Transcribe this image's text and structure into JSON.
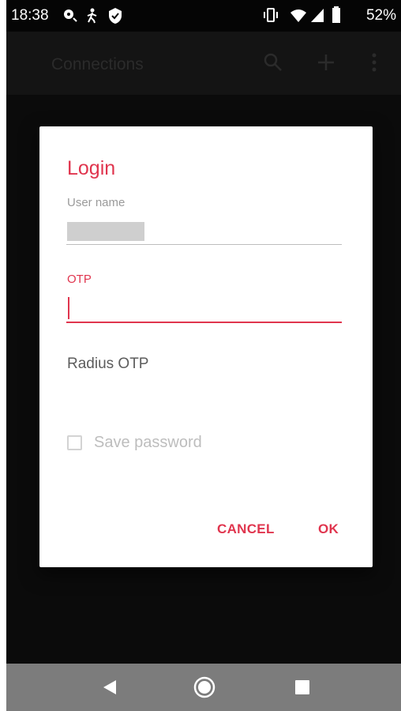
{
  "status_bar": {
    "time": "18:38",
    "battery_percent": "52%",
    "left_icons": [
      "location-pin-icon",
      "walking-person-icon",
      "shield-icon"
    ],
    "right_icons": [
      "vibrate-icon",
      "wifi-icon",
      "signal-icon",
      "battery-icon"
    ]
  },
  "app_bar": {
    "title": "Connections",
    "icons": [
      "search-icon",
      "add-icon",
      "more-vert-icon"
    ]
  },
  "dialog": {
    "title": "Login",
    "username": {
      "label": "User name",
      "value_redacted": true
    },
    "otp": {
      "label": "OTP",
      "value": ""
    },
    "otp_type": "Radius OTP",
    "save_password": {
      "label": "Save password",
      "checked": false,
      "enabled": false
    },
    "buttons": {
      "cancel": "CANCEL",
      "ok": "OK"
    }
  },
  "nav_bar": {
    "icons": [
      "back-icon",
      "home-icon",
      "recents-icon"
    ]
  },
  "colors": {
    "accent": "#e0354e",
    "dialog_bg": "#ffffff",
    "scrim": "#0b0b0b",
    "nav_bar": "#7c7c7c"
  }
}
